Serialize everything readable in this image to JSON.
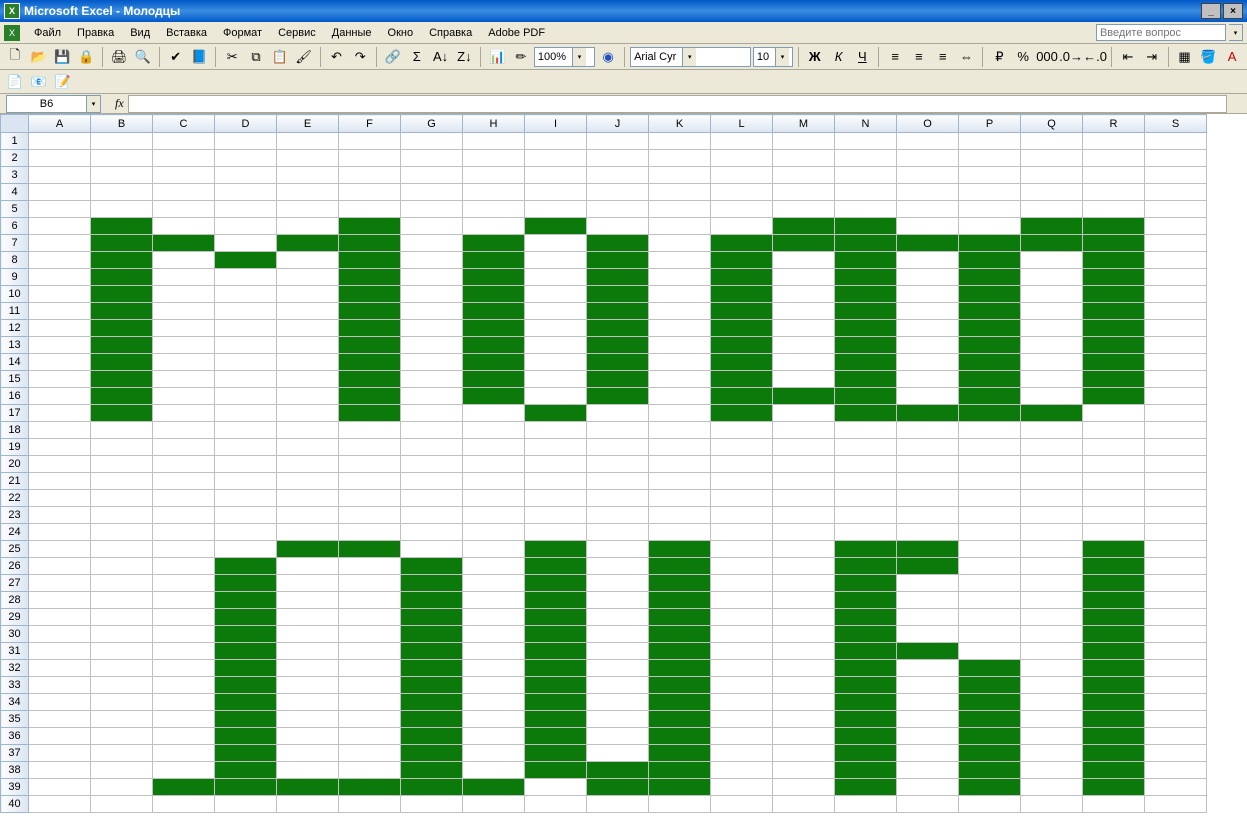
{
  "title": "Microsoft Excel - Молодцы",
  "title_app_letter": "X",
  "menu": {
    "doc_letter": "X",
    "items": [
      "Файл",
      "Правка",
      "Вид",
      "Вставка",
      "Формат",
      "Сервис",
      "Данные",
      "Окно",
      "Справка",
      "Adobe PDF"
    ],
    "question_placeholder": "Введите вопрос"
  },
  "toolbar": {
    "zoom": "100%",
    "font": "Arial Cyr",
    "size": "10",
    "bold": "Ж",
    "italic": "К",
    "underline": "Ч"
  },
  "namebox": "B6",
  "fx": "fx",
  "columns": [
    "A",
    "B",
    "C",
    "D",
    "E",
    "F",
    "G",
    "H",
    "I",
    "J",
    "K",
    "L",
    "M",
    "N",
    "O",
    "P",
    "Q",
    "R",
    "S"
  ],
  "rows": 40,
  "filled": {
    "6": [
      "B",
      "F",
      "I",
      "M",
      "N",
      "Q",
      "R"
    ],
    "7": [
      "B",
      "C",
      "E",
      "F",
      "H",
      "J",
      "L",
      "M",
      "N",
      "O",
      "P",
      "Q",
      "R"
    ],
    "8": [
      "B",
      "D",
      "F",
      "H",
      "J",
      "L",
      "N",
      "P",
      "R"
    ],
    "9": [
      "B",
      "F",
      "H",
      "J",
      "L",
      "N",
      "P",
      "R"
    ],
    "10": [
      "B",
      "F",
      "H",
      "J",
      "L",
      "N",
      "P",
      "R"
    ],
    "11": [
      "B",
      "F",
      "H",
      "J",
      "L",
      "N",
      "P",
      "R"
    ],
    "12": [
      "B",
      "F",
      "H",
      "J",
      "L",
      "N",
      "P",
      "R"
    ],
    "13": [
      "B",
      "F",
      "H",
      "J",
      "L",
      "N",
      "P",
      "R"
    ],
    "14": [
      "B",
      "F",
      "H",
      "J",
      "L",
      "N",
      "P",
      "R"
    ],
    "15": [
      "B",
      "F",
      "H",
      "J",
      "L",
      "N",
      "P",
      "R"
    ],
    "16": [
      "B",
      "F",
      "H",
      "J",
      "L",
      "M",
      "N",
      "P",
      "R"
    ],
    "17": [
      "B",
      "F",
      "I",
      "L",
      "N",
      "O",
      "P",
      "Q"
    ],
    "25": [
      "E",
      "F",
      "I",
      "K",
      "N",
      "O",
      "R"
    ],
    "26": [
      "D",
      "G",
      "I",
      "K",
      "N",
      "O",
      "R"
    ],
    "27": [
      "D",
      "G",
      "I",
      "K",
      "N",
      "R"
    ],
    "28": [
      "D",
      "G",
      "I",
      "K",
      "N",
      "R"
    ],
    "29": [
      "D",
      "G",
      "I",
      "K",
      "N",
      "R"
    ],
    "30": [
      "D",
      "G",
      "I",
      "K",
      "N",
      "R"
    ],
    "31": [
      "D",
      "G",
      "I",
      "K",
      "N",
      "O",
      "R"
    ],
    "32": [
      "D",
      "G",
      "I",
      "K",
      "N",
      "P",
      "R"
    ],
    "33": [
      "D",
      "G",
      "I",
      "K",
      "N",
      "P",
      "R"
    ],
    "34": [
      "D",
      "G",
      "I",
      "K",
      "N",
      "P",
      "R"
    ],
    "35": [
      "D",
      "G",
      "I",
      "K",
      "N",
      "P",
      "R"
    ],
    "36": [
      "D",
      "G",
      "I",
      "K",
      "N",
      "P",
      "R"
    ],
    "37": [
      "D",
      "G",
      "I",
      "K",
      "N",
      "P",
      "R"
    ],
    "38": [
      "D",
      "G",
      "I",
      "J",
      "K",
      "N",
      "P",
      "R"
    ],
    "39": [
      "C",
      "D",
      "E",
      "F",
      "G",
      "H",
      "J",
      "K",
      "N",
      "P",
      "R"
    ]
  }
}
